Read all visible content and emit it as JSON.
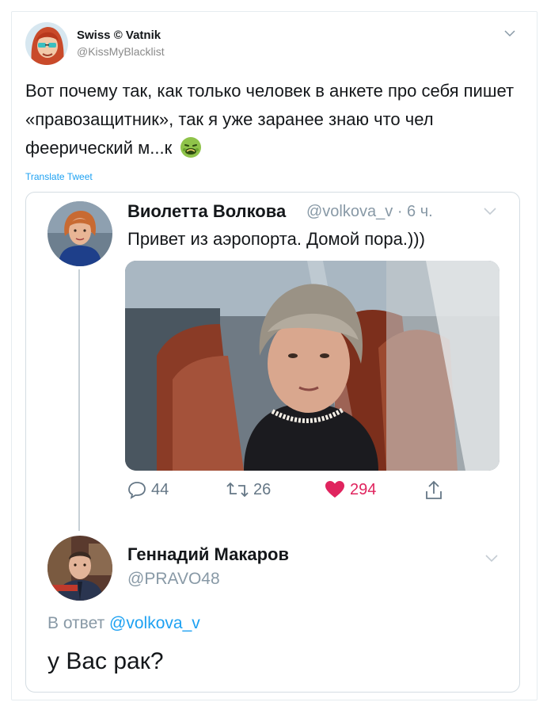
{
  "tweet": {
    "author_name": "Swiss © Vatnik",
    "author_handle": "@KissMyBlacklist",
    "text": "Вот почему так, как только человек в анкете про себя пишет «правозащитник», так я уже заранее знаю что чел феерический м...к",
    "emoji_icon": "nauseated-face-emoji",
    "translate_label": "Translate Tweet"
  },
  "quoted": {
    "name": "Виолетта Волкова",
    "handle": "@volkova_v",
    "time": "· 6 ч.",
    "text": "Привет из аэропорта. Домой пора.)))",
    "actions": {
      "replies": "44",
      "retweets": "26",
      "likes": "294"
    }
  },
  "reply": {
    "name": "Геннадий Макаров",
    "handle": "@PRAVO48",
    "reply_to_prefix": "В ответ",
    "reply_to_mention": "@volkova_v",
    "text": "у Вас рак?"
  },
  "colors": {
    "link": "#1da1f2",
    "like": "#e0245e",
    "muted": "#8899a6"
  }
}
